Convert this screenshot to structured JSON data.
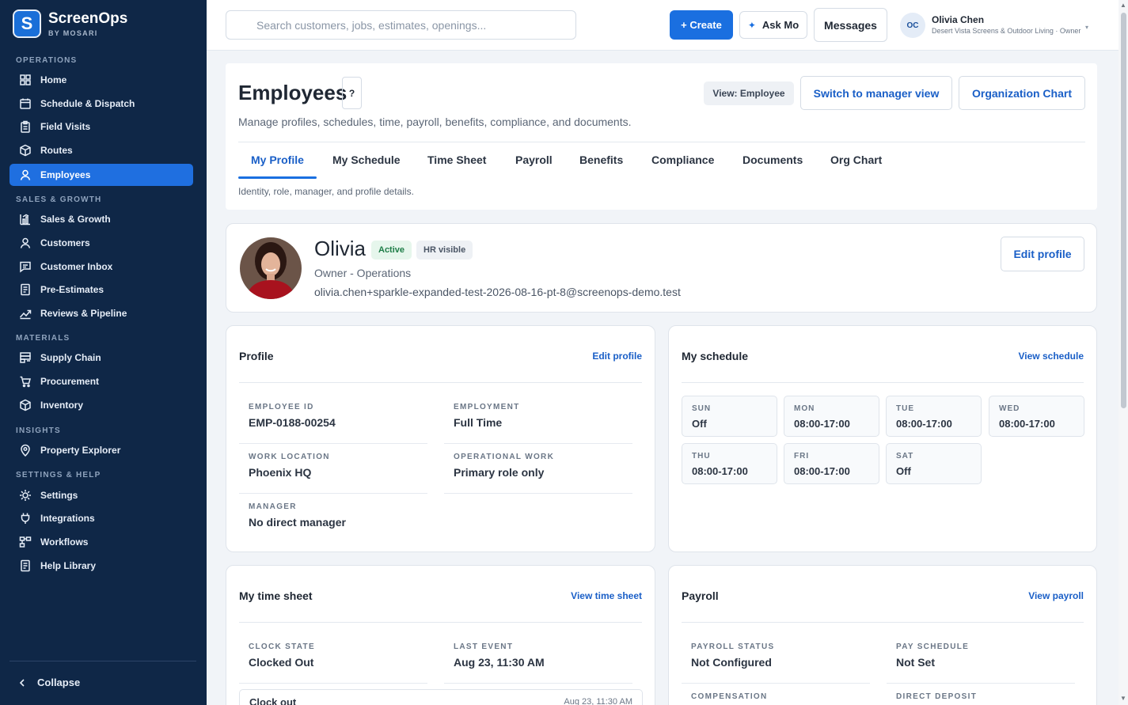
{
  "brand": {
    "logo_letter": "S",
    "name": "ScreenOps",
    "sub": "BY MOSARI"
  },
  "nav": {
    "sections": {
      "operations": "OPERATIONS",
      "sales": "SALES & GROWTH",
      "materials": "MATERIALS",
      "insights": "INSIGHTS",
      "settings": "SETTINGS & HELP"
    },
    "items": [
      {
        "label": "Home",
        "icon": "grid-icon"
      },
      {
        "label": "Schedule & Dispatch",
        "icon": "calendar-icon"
      },
      {
        "label": "Field Visits",
        "icon": "clipboard-icon"
      },
      {
        "label": "Routes",
        "icon": "cube-icon"
      },
      {
        "label": "Employees",
        "icon": "user-icon",
        "active": true
      },
      {
        "label": "Sales & Growth",
        "icon": "bar-chart-icon"
      },
      {
        "label": "Customers",
        "icon": "user-icon"
      },
      {
        "label": "Customer Inbox",
        "icon": "message-icon"
      },
      {
        "label": "Pre-Estimates",
        "icon": "document-icon"
      },
      {
        "label": "Reviews & Pipeline",
        "icon": "trend-icon"
      },
      {
        "label": "Supply Chain",
        "icon": "warehouse-icon"
      },
      {
        "label": "Procurement",
        "icon": "cart-icon"
      },
      {
        "label": "Inventory",
        "icon": "cube-icon"
      },
      {
        "label": "Property Explorer",
        "icon": "map-pin-icon"
      },
      {
        "label": "Settings",
        "icon": "gear-icon"
      },
      {
        "label": "Integrations",
        "icon": "plug-icon"
      },
      {
        "label": "Workflows",
        "icon": "workflow-icon"
      },
      {
        "label": "Help Library",
        "icon": "book-icon"
      }
    ],
    "collapse": "Collapse"
  },
  "topbar": {
    "search_placeholder": "Search customers, jobs, estimates, openings...",
    "create": "+ Create",
    "ask_mo": "Ask Mo",
    "messages": "Messages",
    "user_initials": "OC",
    "user_name": "Olivia Chen",
    "user_org": "Desert Vista Screens & Outdoor Living · Owner"
  },
  "header": {
    "title": "Employees",
    "help": "?",
    "view_badge": "View: Employee",
    "switch_view": "Switch to manager view",
    "org_chart": "Organization Chart",
    "subtitle": "Manage profiles, schedules, time, payroll, benefits, compliance, and documents.",
    "tabs": [
      "My Profile",
      "My Schedule",
      "Time Sheet",
      "Payroll",
      "Benefits",
      "Compliance",
      "Documents",
      "Org Chart"
    ],
    "tab_desc": "Identity, role, manager, and profile details."
  },
  "hero": {
    "name": "Olivia",
    "status": "Active",
    "hr": "HR visible",
    "role": "Owner - Operations",
    "email": "olivia.chen+sparkle-expanded-test-2026-08-16-pt-8@screenops-demo.test",
    "edit": "Edit profile"
  },
  "profile_card": {
    "title": "Profile",
    "link": "Edit profile",
    "fields": [
      {
        "label": "EMPLOYEE ID",
        "value": "EMP-0188-00254"
      },
      {
        "label": "EMPLOYMENT",
        "value": "Full Time"
      },
      {
        "label": "WORK LOCATION",
        "value": "Phoenix HQ"
      },
      {
        "label": "OPERATIONAL WORK",
        "value": "Primary role only"
      },
      {
        "label": "MANAGER",
        "value": "No direct manager"
      }
    ]
  },
  "schedule_card": {
    "title": "My schedule",
    "link": "View schedule",
    "days": [
      {
        "day": "SUN",
        "hours": "Off"
      },
      {
        "day": "MON",
        "hours": "08:00-17:00"
      },
      {
        "day": "TUE",
        "hours": "08:00-17:00"
      },
      {
        "day": "WED",
        "hours": "08:00-17:00"
      },
      {
        "day": "THU",
        "hours": "08:00-17:00"
      },
      {
        "day": "FRI",
        "hours": "08:00-17:00"
      },
      {
        "day": "SAT",
        "hours": "Off"
      }
    ]
  },
  "timesheet_card": {
    "title": "My time sheet",
    "link": "View time sheet",
    "fields": [
      {
        "label": "CLOCK STATE",
        "value": "Clocked Out"
      },
      {
        "label": "LAST EVENT",
        "value": "Aug 23, 11:30 AM"
      }
    ],
    "entry": {
      "label": "Clock out",
      "time": "Aug 23, 11:30 AM"
    }
  },
  "payroll_card": {
    "title": "Payroll",
    "link": "View payroll",
    "fields": [
      {
        "label": "PAYROLL STATUS",
        "value": "Not Configured"
      },
      {
        "label": "PAY SCHEDULE",
        "value": "Not Set"
      },
      {
        "label": "COMPENSATION",
        "value": ""
      },
      {
        "label": "DIRECT DEPOSIT",
        "value": ""
      }
    ]
  }
}
